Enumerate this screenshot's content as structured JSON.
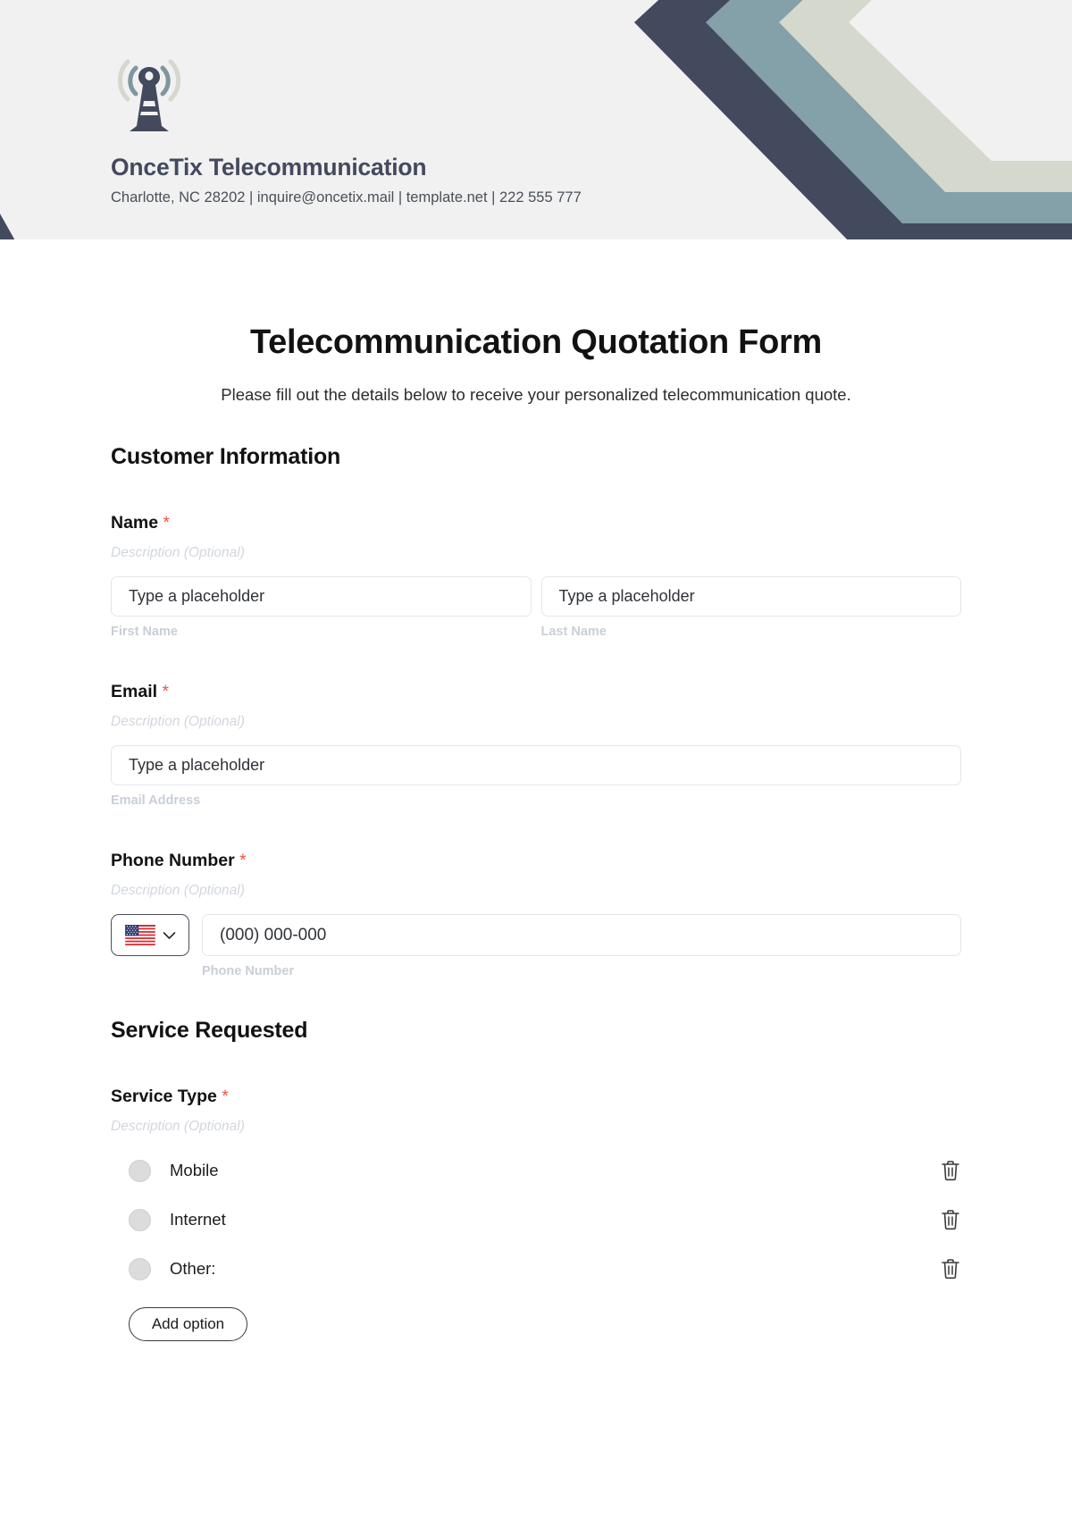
{
  "header": {
    "logo_icon": "telecom-tower-icon",
    "company_name": "OnceTix Telecommunication",
    "contact_line": "Charlotte, NC 28202 | inquire@oncetix.mail | template.net | 222 555 777",
    "colors": {
      "band_background": "#f1f1f1",
      "chevron_dark": "#434a5e",
      "chevron_slate": "#84a0a8",
      "chevron_sage": "#d4d8cd",
      "brand_text": "#434a5e"
    }
  },
  "form": {
    "title": "Telecommunication Quotation Form",
    "subtitle": "Please fill out the details below to receive your personalized telecommunication quote.",
    "required_marker": "*",
    "description_placeholder": "Description (Optional)",
    "sections": [
      {
        "heading": "Customer Information"
      },
      {
        "heading": "Service Requested"
      }
    ],
    "fields": {
      "name": {
        "label": "Name",
        "description": "Description (Optional)",
        "first": {
          "placeholder": "Type a placeholder",
          "sub_label": "First Name"
        },
        "last": {
          "placeholder": "Type a placeholder",
          "sub_label": "Last Name"
        }
      },
      "email": {
        "label": "Email",
        "description": "Description (Optional)",
        "placeholder": "Type a placeholder",
        "sub_label": "Email Address"
      },
      "phone": {
        "label": "Phone Number",
        "description": "Description (Optional)",
        "country_flag": "us-flag-icon",
        "dropdown_icon": "chevron-down-icon",
        "placeholder": "(000) 000-000",
        "sub_label": "Phone Number"
      },
      "service_type": {
        "label": "Service Type",
        "description": "Description (Optional)",
        "options": [
          {
            "label": "Mobile",
            "delete_icon": "trash-icon"
          },
          {
            "label": "Internet",
            "delete_icon": "trash-icon"
          },
          {
            "label": "Other:",
            "delete_icon": "trash-icon"
          }
        ],
        "add_option_label": "Add option"
      }
    }
  }
}
